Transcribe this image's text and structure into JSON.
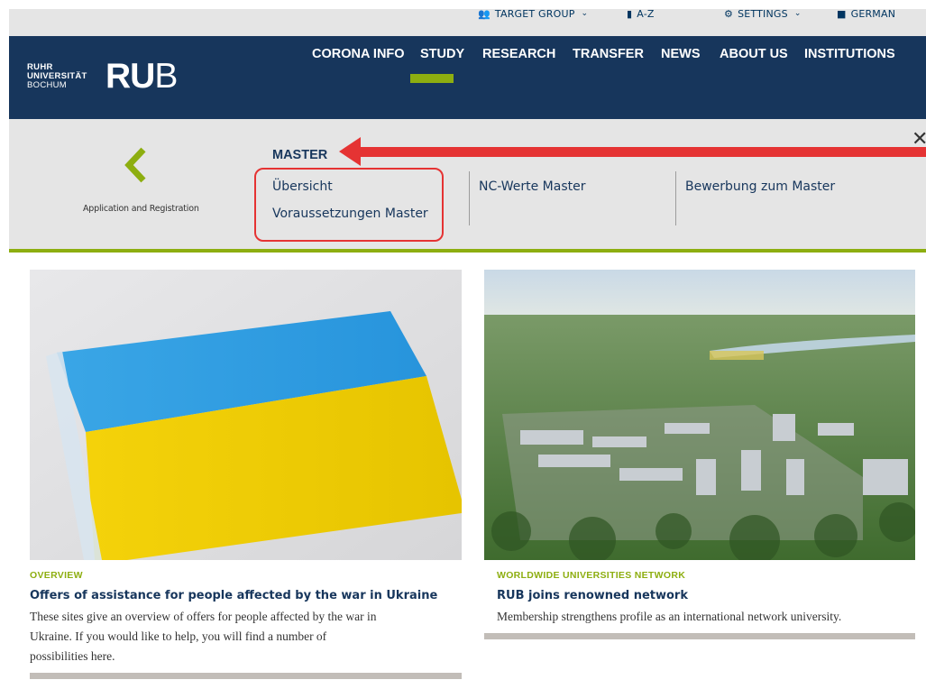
{
  "utility_bar": {
    "target_group": "TARGET GROUP",
    "az": "A-Z",
    "settings": "SETTINGS",
    "language": "GERMAN"
  },
  "logo": {
    "line1": "RUHR",
    "line2": "UNIVERSITÄT",
    "line3": "BOCHUM",
    "mark_bold": "RU",
    "mark_thin": "B"
  },
  "nav": {
    "items": [
      "CORONA INFO",
      "STUDY",
      "RESEARCH",
      "TRANSFER",
      "NEWS",
      "ABOUT US",
      "INSTITUTIONS"
    ],
    "active": "STUDY"
  },
  "submenu": {
    "back_label": "Application and Registration",
    "title": "MASTER",
    "links": [
      "Übersicht",
      "Voraussetzungen Master",
      "NC-Werte Master",
      "Bewerbung zum Master"
    ]
  },
  "colors": {
    "navy": "#17365c",
    "green": "#8dae10",
    "annotation_red": "#e53333"
  },
  "cards": [
    {
      "kicker": "OVERVIEW",
      "title": "Offers of assistance for people affected by the war in Ukraine",
      "text_lines": [
        "These sites give an overview of offers for people affected by the war in",
        "Ukraine. If you would like to help, you will find a number of",
        "possibilities here."
      ]
    },
    {
      "kicker": "WORLDWIDE UNIVERSITIES NETWORK",
      "title": "RUB joins renowned network",
      "text_lines": [
        "Membership strengthens profile as an international network university."
      ]
    }
  ]
}
